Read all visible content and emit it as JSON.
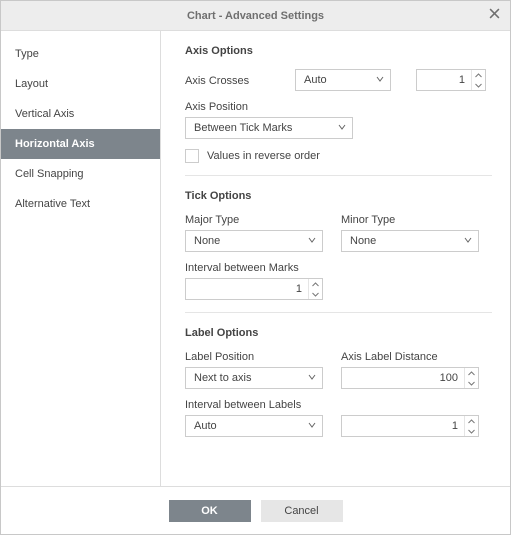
{
  "title": "Chart - Advanced Settings",
  "sidebar": {
    "items": [
      {
        "label": "Type"
      },
      {
        "label": "Layout"
      },
      {
        "label": "Vertical Axis"
      },
      {
        "label": "Horizontal Axis"
      },
      {
        "label": "Cell Snapping"
      },
      {
        "label": "Alternative Text"
      }
    ],
    "activeIndex": 3
  },
  "axisOptions": {
    "sectionTitle": "Axis Options",
    "axisCrossesLabel": "Axis Crosses",
    "axisCrossesValue": "Auto",
    "axisCrossesNumber": "1",
    "axisPositionLabel": "Axis Position",
    "axisPositionValue": "Between Tick Marks",
    "reverseLabel": "Values in reverse order",
    "reverseChecked": false
  },
  "tickOptions": {
    "sectionTitle": "Tick Options",
    "majorTypeLabel": "Major Type",
    "majorTypeValue": "None",
    "minorTypeLabel": "Minor Type",
    "minorTypeValue": "None",
    "intervalMarksLabel": "Interval between Marks",
    "intervalMarksValue": "1"
  },
  "labelOptions": {
    "sectionTitle": "Label Options",
    "labelPositionLabel": "Label Position",
    "labelPositionValue": "Next to axis",
    "axisLabelDistanceLabel": "Axis Label Distance",
    "axisLabelDistanceValue": "100",
    "intervalLabelsLabel": "Interval between Labels",
    "intervalLabelsValue": "Auto",
    "intervalLabelsNumber": "1"
  },
  "footer": {
    "okLabel": "OK",
    "cancelLabel": "Cancel"
  }
}
